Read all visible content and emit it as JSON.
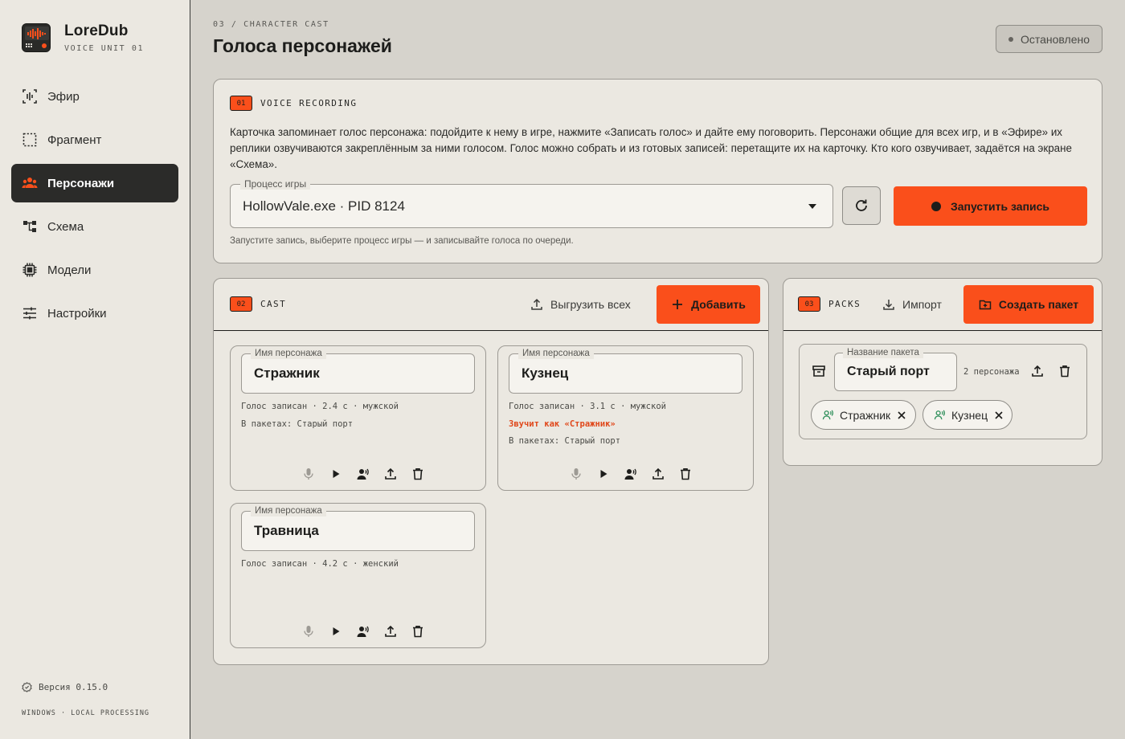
{
  "app": {
    "name": "LoreDub",
    "subtitle": "VOICE UNIT 01",
    "version": "Версия 0.15.0",
    "platform": "WINDOWS · LOCAL PROCESSING"
  },
  "sidebar": {
    "items": [
      {
        "label": "Эфир",
        "icon": "broadcast-icon",
        "active": false
      },
      {
        "label": "Фрагмент",
        "icon": "selection-icon",
        "active": false
      },
      {
        "label": "Персонажи",
        "icon": "people-icon",
        "active": true
      },
      {
        "label": "Схема",
        "icon": "diagram-icon",
        "active": false
      },
      {
        "label": "Модели",
        "icon": "chip-icon",
        "active": false
      },
      {
        "label": "Настройки",
        "icon": "sliders-icon",
        "active": false
      }
    ]
  },
  "header": {
    "breadcrumb": "03  /  CHARACTER CAST",
    "title": "Голоса персонажей",
    "status": "Остановлено"
  },
  "recording": {
    "tag": "01",
    "title": "VOICE RECORDING",
    "description": "Карточка запоминает голос персонажа: подойдите к нему в игре, нажмите «Записать голос» и дайте ему поговорить. Персонажи общие для всех игр, и в «Эфире» их реплики озвучиваются закреплённым за ними голосом. Голос можно собрать и из готовых записей: перетащите их на карточку. Кто кого озвучивает, задаётся на экране «Схема».",
    "process_label": "Процесс игры",
    "process_value": "HollowVale.exe  ·  PID 8124",
    "start_label": "Запустить запись",
    "hint": "Запустите запись, выберите процесс игры — и записывайте голоса по очереди."
  },
  "cast": {
    "tag": "02",
    "title": "CAST",
    "export_all_label": "Выгрузить всех",
    "add_label": "Добавить",
    "name_legend": "Имя персонажа",
    "characters": [
      {
        "name": "Стражник",
        "meta": [
          "Голос записан · 2.4 с · мужской",
          "В пакетах: Старый порт"
        ],
        "alert": ""
      },
      {
        "name": "Кузнец",
        "meta": [
          "Голос записан · 3.1 с · мужской",
          "В пакетах: Старый порт"
        ],
        "alert": "Звучит как «Стражник»"
      },
      {
        "name": "Травница",
        "meta": [
          "Голос записан · 4.2 с · женский",
          ""
        ],
        "alert": ""
      }
    ]
  },
  "packs": {
    "tag": "03",
    "title": "PACKS",
    "import_label": "Импорт",
    "create_label": "Создать пакет",
    "pack_legend": "Название пакета",
    "pack": {
      "name": "Старый порт",
      "count": "2 персонажа",
      "members": [
        "Стражник",
        "Кузнец"
      ]
    }
  },
  "colors": {
    "accent": "#fa4f1b",
    "sidebar_bg": "#ebe8e1",
    "page_bg": "#d6d3cc",
    "active_nav": "#2b2b29",
    "voice_chip_icon": "#2f8f5b"
  }
}
